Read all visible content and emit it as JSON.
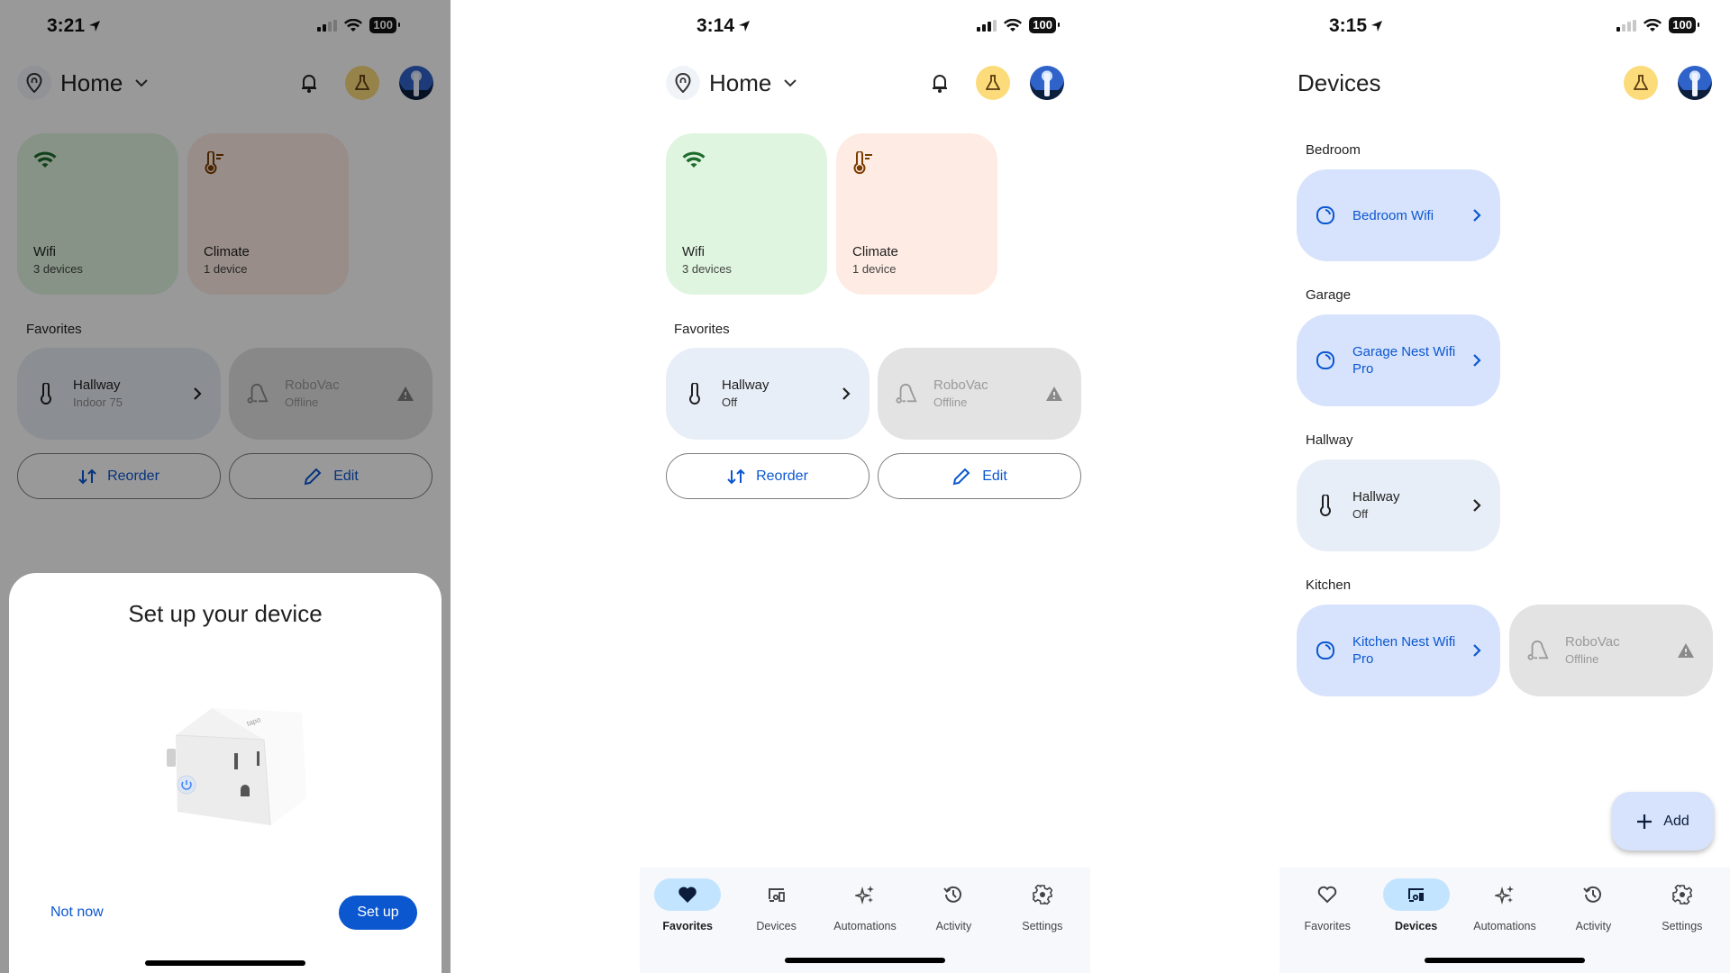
{
  "panels": {
    "setup_modal_screen": {
      "status": {
        "time": "3:21",
        "battery": "100"
      },
      "header": {
        "title": "Home"
      },
      "categories": [
        {
          "name": "Wifi",
          "count": "3 devices",
          "icon": "wifi-icon"
        },
        {
          "name": "Climate",
          "count": "1 device",
          "icon": "thermostat-icon"
        }
      ],
      "favorites_label": "Favorites",
      "favorites": [
        {
          "name": "Hallway",
          "status": "Indoor 75",
          "icon": "thermometer-icon"
        },
        {
          "name": "RoboVac",
          "status": "Offline",
          "icon": "vacuum-icon"
        }
      ],
      "buttons": {
        "reorder": "Reorder",
        "edit": "Edit"
      },
      "modal": {
        "title": "Set up your device",
        "image": "smart-plug",
        "secondary": "Not now",
        "primary": "Set up"
      }
    },
    "favorites_screen": {
      "status": {
        "time": "3:14",
        "battery": "100"
      },
      "header": {
        "title": "Home"
      },
      "categories": [
        {
          "name": "Wifi",
          "count": "3 devices",
          "icon": "wifi-icon"
        },
        {
          "name": "Climate",
          "count": "1 device",
          "icon": "thermostat-icon"
        }
      ],
      "favorites_label": "Favorites",
      "favorites": [
        {
          "name": "Hallway",
          "status": "Off",
          "icon": "thermometer-icon"
        },
        {
          "name": "RoboVac",
          "status": "Offline",
          "icon": "vacuum-icon"
        }
      ],
      "buttons": {
        "reorder": "Reorder",
        "edit": "Edit"
      },
      "nav": [
        {
          "label": "Favorites",
          "active": true
        },
        {
          "label": "Devices",
          "active": false
        },
        {
          "label": "Automations",
          "active": false
        },
        {
          "label": "Activity",
          "active": false
        },
        {
          "label": "Settings",
          "active": false
        }
      ]
    },
    "devices_screen": {
      "status": {
        "time": "3:15",
        "battery": "100"
      },
      "header": {
        "title": "Devices"
      },
      "rooms": [
        {
          "name": "Bedroom",
          "devices": [
            {
              "name": "Bedroom Wifi",
              "type": "wifi"
            }
          ]
        },
        {
          "name": "Garage",
          "devices": [
            {
              "name": "Garage Nest Wifi Pro",
              "type": "wifi"
            }
          ]
        },
        {
          "name": "Hallway",
          "devices": [
            {
              "name": "Hallway",
              "status": "Off",
              "type": "thermostat"
            }
          ]
        },
        {
          "name": "Kitchen",
          "devices": [
            {
              "name": "Kitchen Nest Wifi Pro",
              "type": "wifi"
            },
            {
              "name": "RoboVac",
              "status": "Offline",
              "type": "vacuum"
            }
          ]
        }
      ],
      "fab": "Add",
      "nav": [
        {
          "label": "Favorites",
          "active": false
        },
        {
          "label": "Devices",
          "active": true
        },
        {
          "label": "Automations",
          "active": false
        },
        {
          "label": "Activity",
          "active": false
        },
        {
          "label": "Settings",
          "active": false
        }
      ]
    }
  },
  "colors": {
    "accent": "#0b57d0",
    "wifi_tile": "#dff5df",
    "climate_tile": "#feebe3",
    "device_tile": "#d7e3fc",
    "nav_active": "#c2e4ff",
    "lab_badge": "#fbdb7a"
  }
}
